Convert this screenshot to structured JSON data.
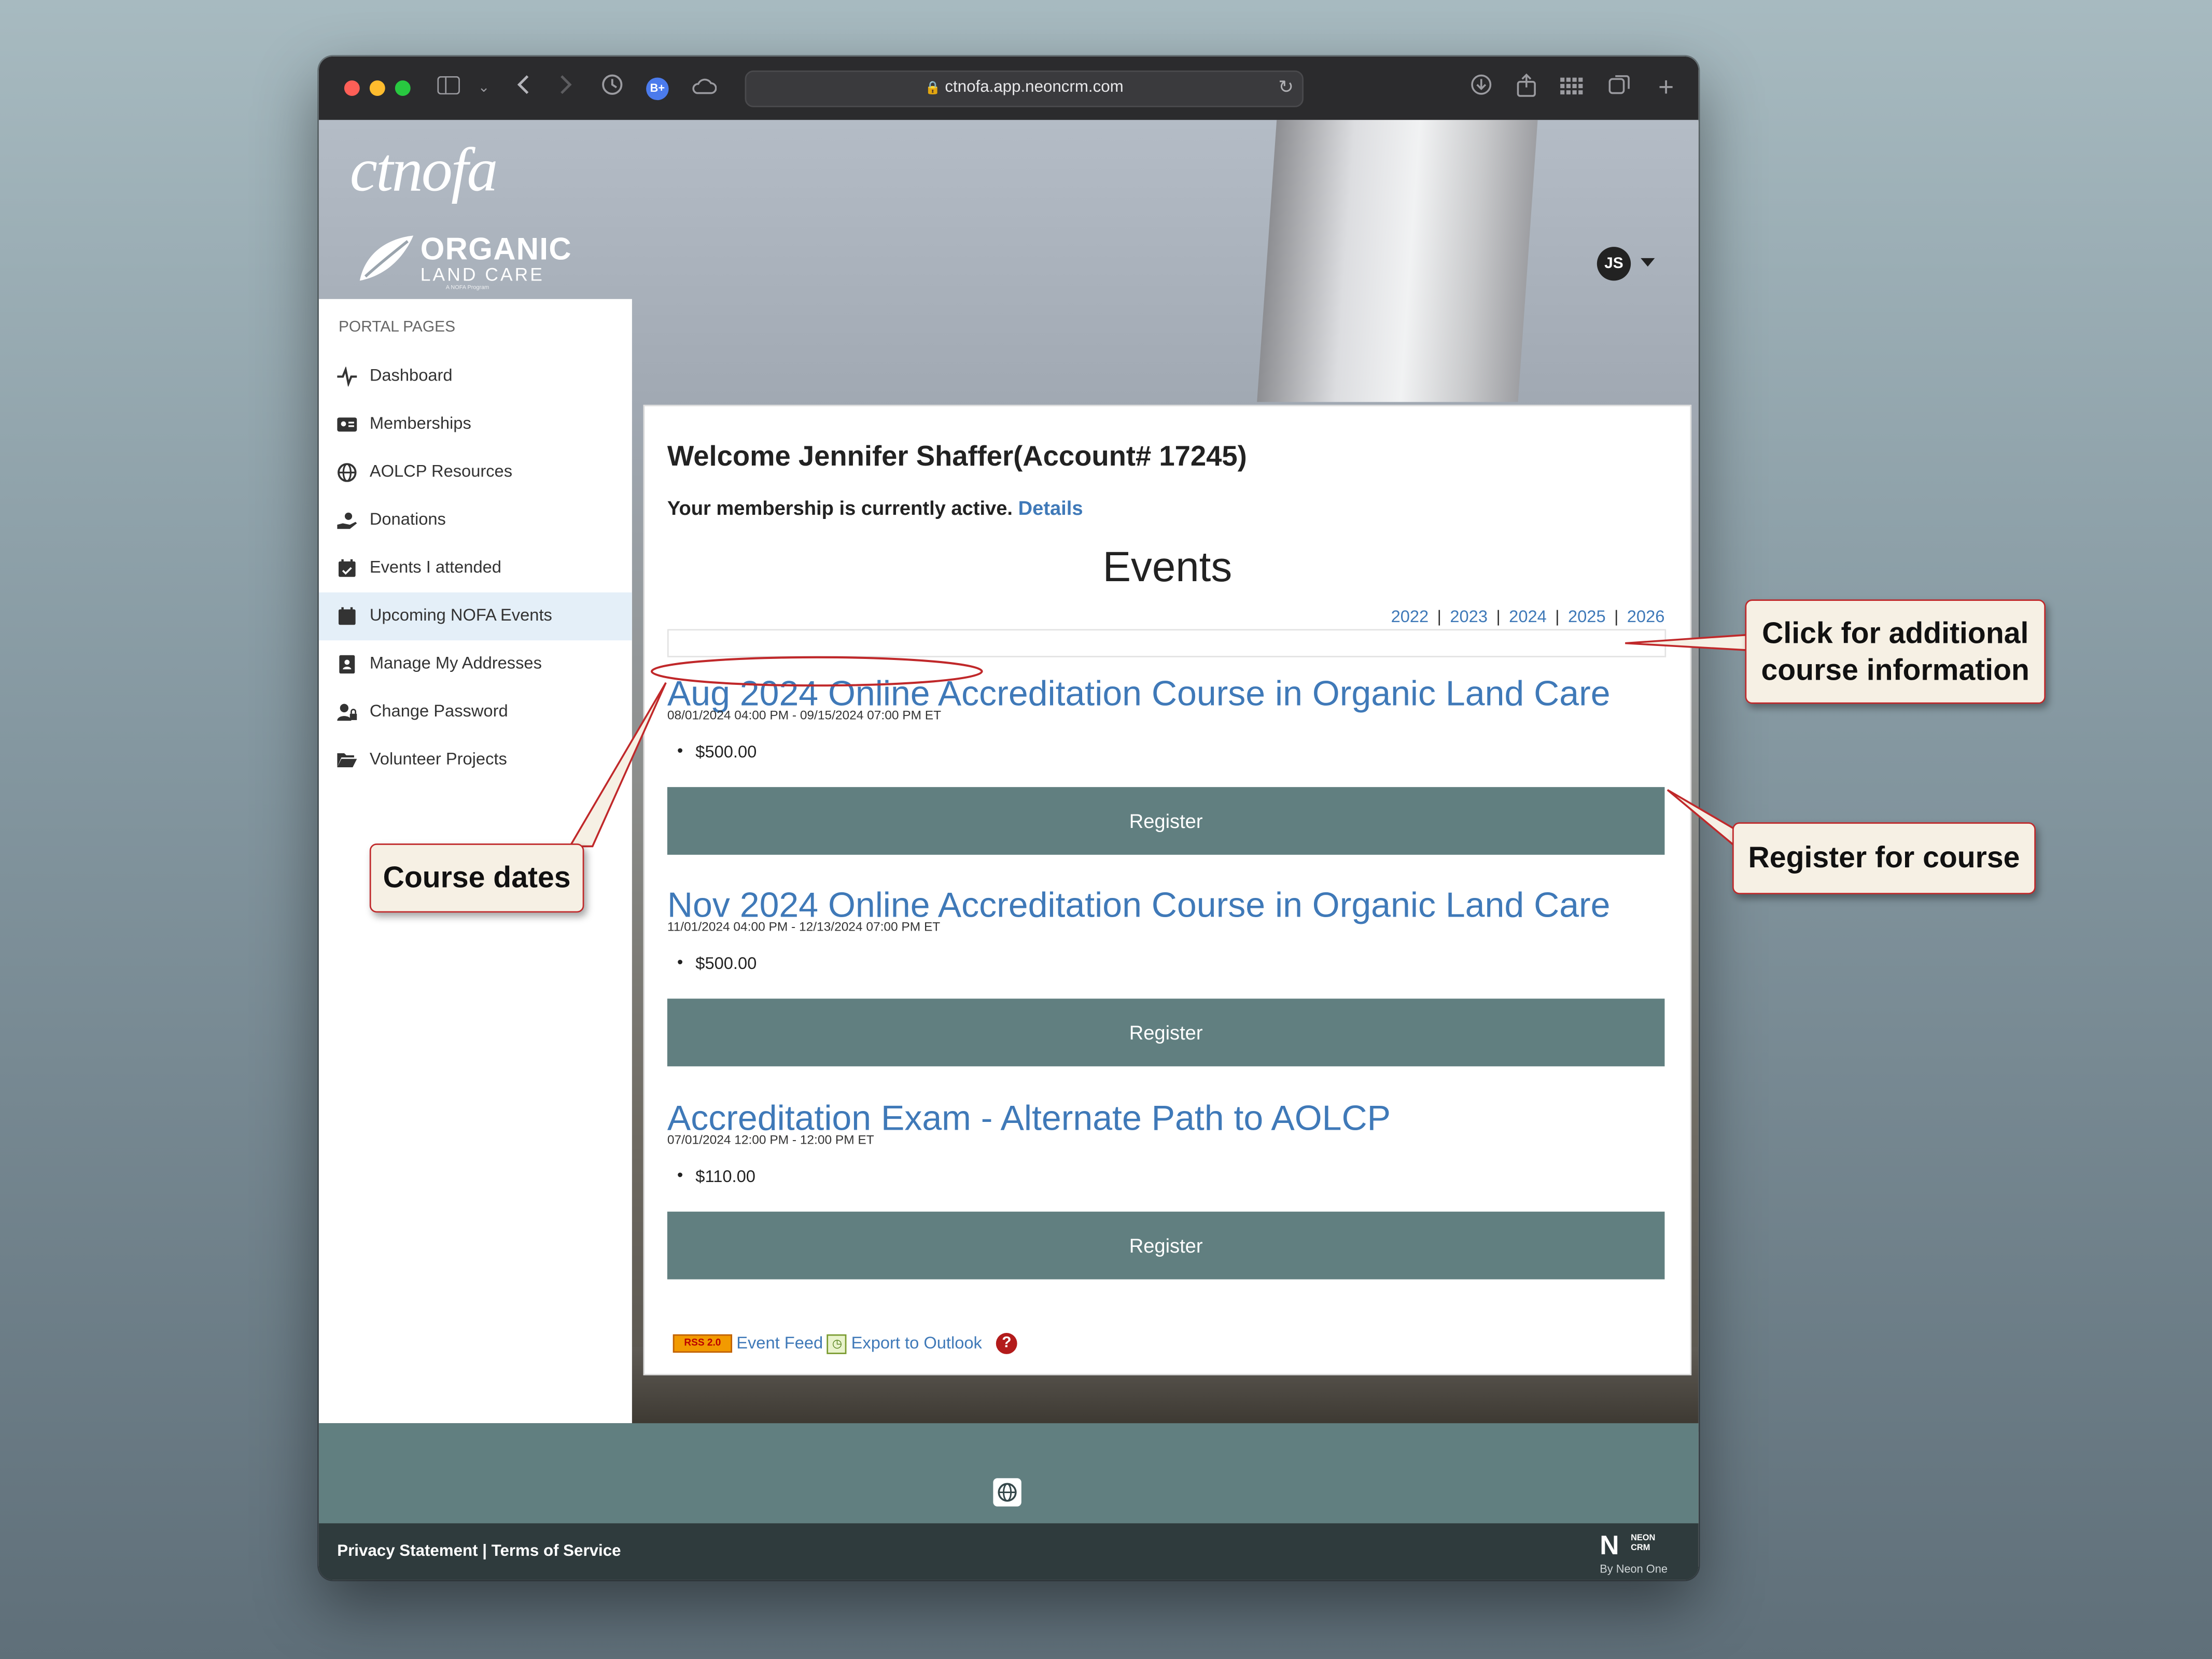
{
  "browser": {
    "url": "ctnofa.app.neoncrm.com",
    "profile_badge": "B+"
  },
  "logo": {
    "brand": "ctnofa",
    "line1": "ORGANIC",
    "line2": "LAND CARE",
    "subline": "A NOFA Program"
  },
  "user": {
    "initials": "JS"
  },
  "sidebar": {
    "heading": "PORTAL PAGES",
    "items": [
      {
        "label": "Dashboard",
        "icon": "activity-icon"
      },
      {
        "label": "Memberships",
        "icon": "id-card-icon"
      },
      {
        "label": "AOLCP Resources",
        "icon": "globe-icon"
      },
      {
        "label": "Donations",
        "icon": "hand-holding-icon"
      },
      {
        "label": "Events I attended",
        "icon": "calendar-check-icon"
      },
      {
        "label": "Upcoming NOFA Events",
        "icon": "calendar-icon",
        "active": true
      },
      {
        "label": "Manage My Addresses",
        "icon": "address-book-icon"
      },
      {
        "label": "Change Password",
        "icon": "user-lock-icon"
      },
      {
        "label": "Volunteer Projects",
        "icon": "folder-open-icon"
      }
    ]
  },
  "main": {
    "welcome": "Welcome Jennifer Shaffer(Account# 17245)",
    "status_text": "Your membership is currently active.",
    "status_link": "Details",
    "events_heading": "Events",
    "years": [
      "2022",
      "2023",
      "2024",
      "2025",
      "2026"
    ],
    "events": [
      {
        "name": "Aug 2024 Online Accreditation Course in Organic Land Care",
        "dates": "08/01/2024 04:00 PM - 09/15/2024 07:00 PM ET",
        "price": "$500.00",
        "button": "Register"
      },
      {
        "name": "Nov 2024 Online Accreditation Course in Organic Land Care",
        "dates": "11/01/2024 04:00 PM - 12/13/2024 07:00 PM ET",
        "price": "$500.00",
        "button": "Register"
      },
      {
        "name": "Accreditation Exam - Alternate Path to AOLCP",
        "dates": "07/01/2024 12:00 PM - 12:00 PM ET",
        "price": "$110.00",
        "button": "Register"
      }
    ],
    "rss_badge": "RSS 2.0",
    "event_feed": "Event Feed",
    "export_outlook": "Export to Outlook",
    "help": "?"
  },
  "footer": {
    "links": "Privacy Statement | Terms of Service",
    "brand": "NEON CRM",
    "by": "By Neon One"
  },
  "callouts": {
    "info_line1": "Click for additional",
    "info_line2": "course information",
    "register": "Register for course",
    "dates": "Course dates"
  },
  "colors": {
    "link": "#3f79b8",
    "register_button": "#617f80",
    "callout_border": "#c0282a",
    "callout_bg": "#f6f0e4",
    "active_nav": "#e4eff8"
  }
}
